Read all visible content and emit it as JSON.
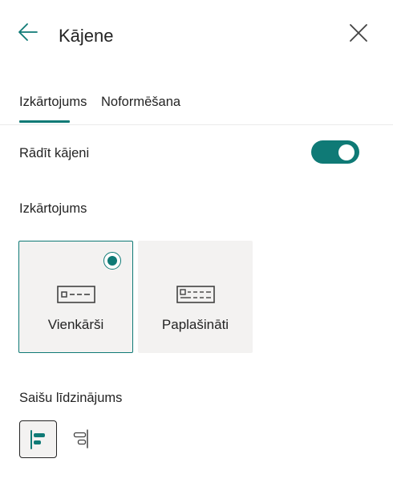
{
  "panel": {
    "title": "Kājene",
    "back_icon": "arrow-left-icon",
    "close_icon": "close-icon"
  },
  "tabs": [
    {
      "label": "Izkārtojums",
      "selected": true
    },
    {
      "label": "Noformēšana",
      "selected": false
    }
  ],
  "show_footer": {
    "label": "Rādīt kājeni",
    "enabled": true
  },
  "layout": {
    "label": "Izkārtojums",
    "options": [
      {
        "label": "Vienkārši",
        "selected": true,
        "icon": "footer-simple-icon"
      },
      {
        "label": "Paplašināti",
        "selected": false,
        "icon": "footer-extended-icon"
      }
    ]
  },
  "link_alignment": {
    "label": "Saišu līdzinājums",
    "options": [
      {
        "name": "left",
        "selected": true,
        "icon": "align-left-icon"
      },
      {
        "name": "right",
        "selected": false,
        "icon": "align-right-icon"
      }
    ]
  },
  "colors": {
    "accent": "#0f7a76",
    "card_background": "#f3f2f1",
    "text": "#242424"
  }
}
